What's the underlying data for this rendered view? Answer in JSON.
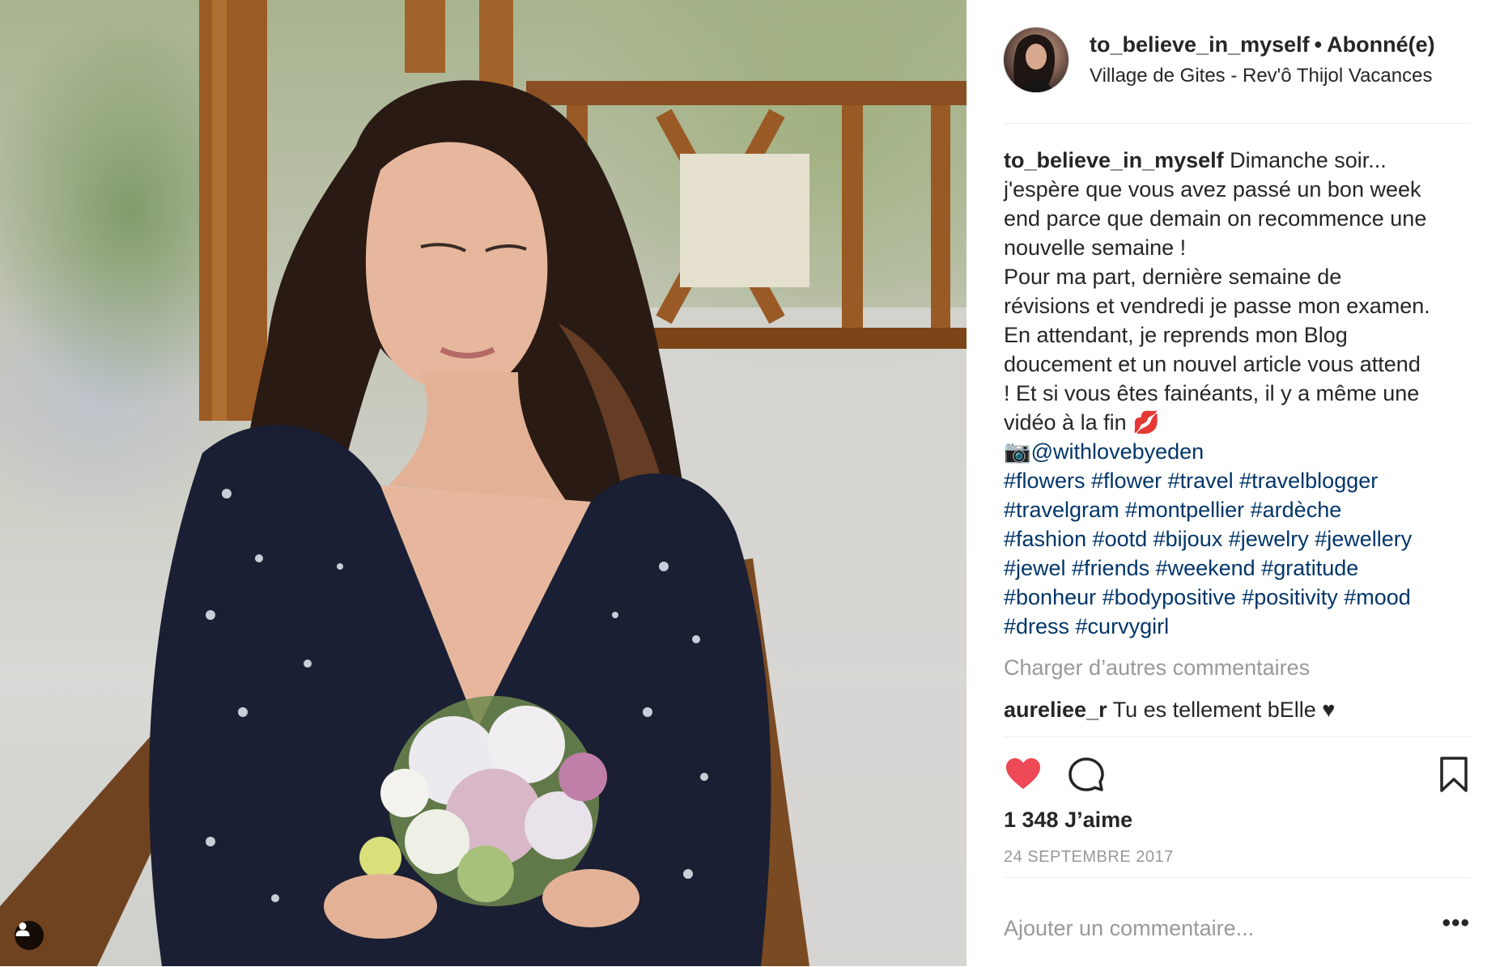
{
  "header": {
    "username": "to_believe_in_myself",
    "separator": "•",
    "follow_status": "Abonné(e)",
    "location": "Village de Gites - Rev'ô Thijol Vacances",
    "avatar_icon": "profile-avatar"
  },
  "caption": {
    "username": "to_believe_in_myself",
    "lines": [
      "Dimanche soir...",
      "j'espère que vous avez passé un bon week",
      "end parce que demain on recommence une",
      "nouvelle semaine !",
      "Pour ma part, dernière semaine de",
      "révisions et vendredi je passe mon examen.",
      "En attendant, je reprends mon Blog",
      "doucement et un nouvel article vous attend",
      "! Et si vous êtes fainéants, il y a même une",
      "vidéo à la fin 💋"
    ],
    "camera_emoji": "📷",
    "mention": "@withlovebyeden",
    "hashtag_lines": [
      "#flowers #flower #travel #travelblogger",
      "#travelgram #montpellier #ardèche",
      "#fashion #ootd #bijoux #jewelry #jewellery",
      "#jewel #friends #weekend #gratitude",
      "#bonheur #bodypositive #positivity #mood",
      "#dress #curvygirl"
    ]
  },
  "load_more_comments": "Charger d’autres commentaires",
  "comments": [
    {
      "username": "aureliee_r",
      "text": "Tu es tellement bElle ♥"
    }
  ],
  "actions": {
    "like_icon": "heart-icon",
    "liked": true,
    "like_color": "#ed4956",
    "comment_icon": "comment-bubble-icon",
    "save_icon": "bookmark-icon"
  },
  "likes_text": "1 348 J’aime",
  "date": "24 SEPTEMBRE 2017",
  "add_comment": {
    "placeholder": "Ajouter un commentaire..."
  },
  "more_options": "•••",
  "colors": {
    "text": "#262626",
    "muted": "#999999",
    "link": "#003569",
    "divider": "#efefef"
  }
}
